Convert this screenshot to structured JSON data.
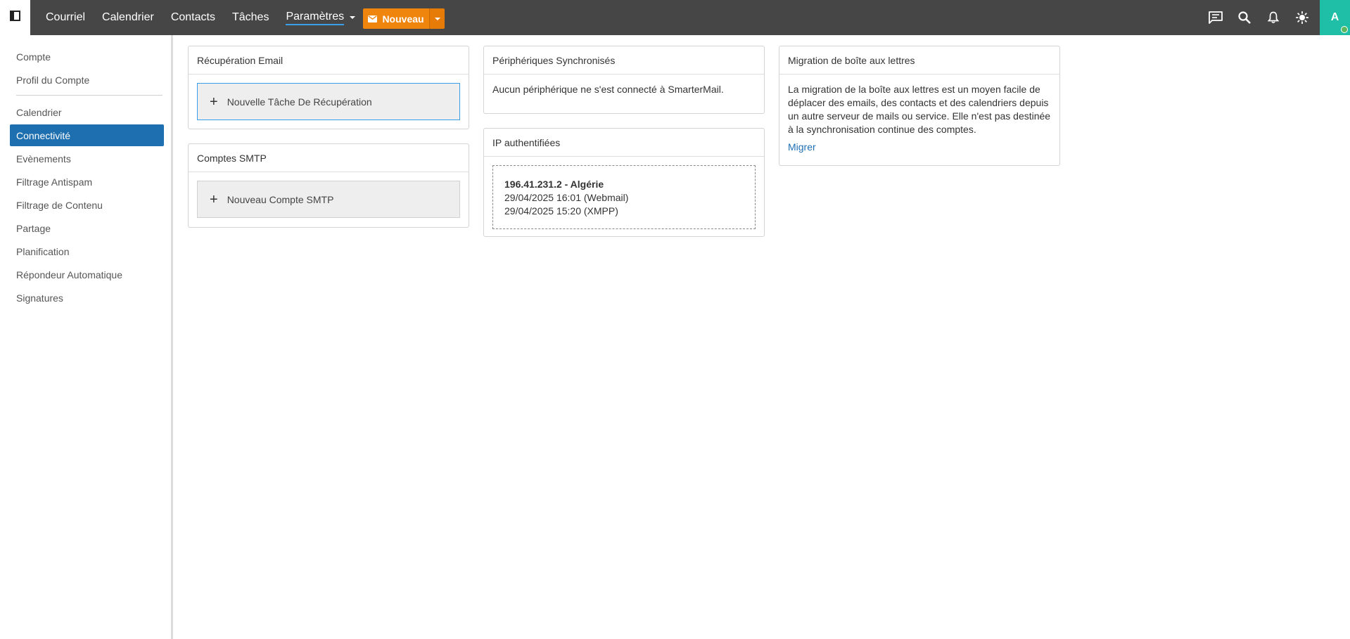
{
  "topbar": {
    "nav": [
      {
        "label": "Courriel"
      },
      {
        "label": "Calendrier"
      },
      {
        "label": "Contacts"
      },
      {
        "label": "Tâches"
      },
      {
        "label": "Paramètres"
      }
    ],
    "new_button_label": "Nouveau",
    "avatar_initial": "A",
    "icons": [
      "chat-icon",
      "search-icon",
      "bell-icon",
      "sun-icon"
    ]
  },
  "sidebar": {
    "items": [
      {
        "label": "Compte"
      },
      {
        "label": "Profil du Compte"
      },
      {
        "label": "Calendrier"
      },
      {
        "label": "Connectivité"
      },
      {
        "label": "Evènements"
      },
      {
        "label": "Filtrage Antispam"
      },
      {
        "label": "Filtrage de Contenu"
      },
      {
        "label": "Partage"
      },
      {
        "label": "Planification"
      },
      {
        "label": "Répondeur Automatique"
      },
      {
        "label": "Signatures"
      }
    ],
    "active_label": "Connectivité"
  },
  "cards": {
    "recuperation": {
      "title": "Récupération Email",
      "button": "Nouvelle Tâche De Récupération"
    },
    "smtp": {
      "title": "Comptes SMTP",
      "button": "Nouveau Compte SMTP"
    },
    "devices": {
      "title": "Périphériques Synchronisés",
      "text": "Aucun périphérique ne s'est connecté à SmarterMail."
    },
    "ips": {
      "title": "IP authentifiées",
      "entries": [
        {
          "heading": "196.41.231.2 - Algérie",
          "line1": "29/04/2025 16:01 (Webmail)",
          "line2": "29/04/2025 15:20 (XMPP)"
        }
      ]
    },
    "migration": {
      "title": "Migration de boîte aux lettres",
      "text": "La migration de la boîte aux lettres est un moyen facile de déplacer des emails, des contacts et des calendriers depuis un autre serveur de mails ou service. Elle n'est pas destinée à la synchronisation continue des comptes.",
      "link": "Migrer"
    }
  },
  "colors": {
    "topbar": "#464646",
    "accent": "#1e6fb0",
    "new_button": "#f0850e",
    "avatar": "#1ebfa6",
    "link": "#1f6fb3"
  }
}
